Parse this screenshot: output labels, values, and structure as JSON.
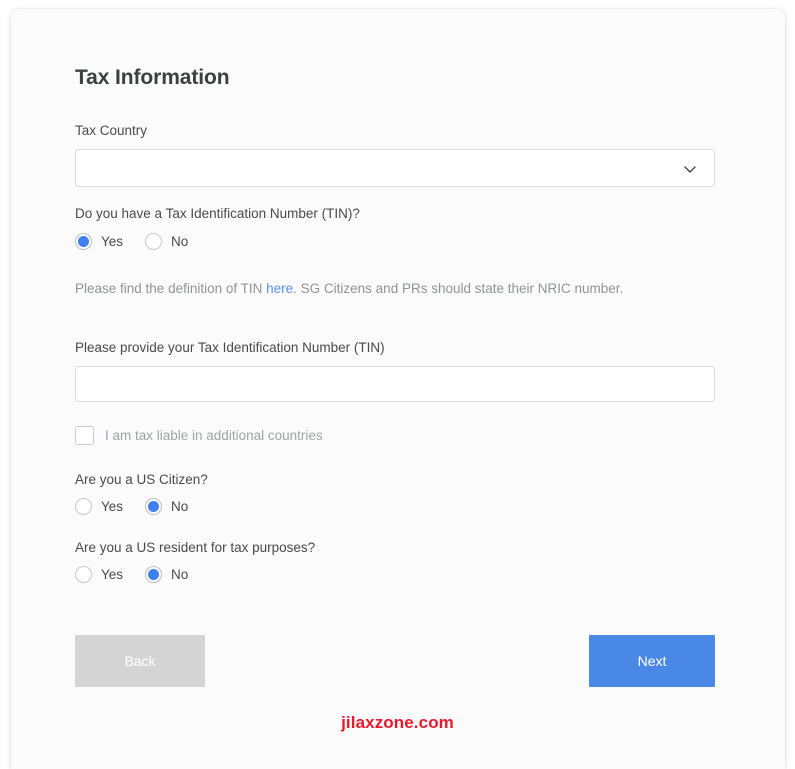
{
  "form": {
    "title": "Tax Information",
    "tax_country": {
      "label": "Tax Country",
      "value": "",
      "placeholder": "",
      "icon": "chevron-down-icon"
    },
    "has_tin": {
      "question": "Do you have a Tax Identification Number (TIN)?",
      "options": [
        "Yes",
        "No"
      ],
      "selected": "Yes"
    },
    "help": {
      "before": "Please find the definition of TIN ",
      "link": "here",
      "after": ". SG Citizens and PRs should state their NRIC number."
    },
    "tin_number": {
      "label": "Please provide your Tax Identification Number (TIN)",
      "value": "",
      "placeholder": ""
    },
    "additional_countries": {
      "label": "I am tax liable in additional countries",
      "checked": false
    },
    "us_citizen": {
      "question": "Are you a US Citizen?",
      "options": [
        "Yes",
        "No"
      ],
      "selected": "No"
    },
    "us_resident": {
      "question": "Are you a US resident for tax purposes?",
      "options": [
        "Yes",
        "No"
      ],
      "selected": "No"
    },
    "buttons": {
      "back": "Back",
      "next": "Next"
    }
  },
  "watermark": {
    "text": "jilaxzone.com"
  },
  "colors": {
    "accent_blue": "#4a88e5",
    "radio_blue": "#3f7ff0",
    "link_blue": "#5b90e8",
    "disabled_gray": "#d4d4d4",
    "watermark_red": "#e8192c"
  }
}
